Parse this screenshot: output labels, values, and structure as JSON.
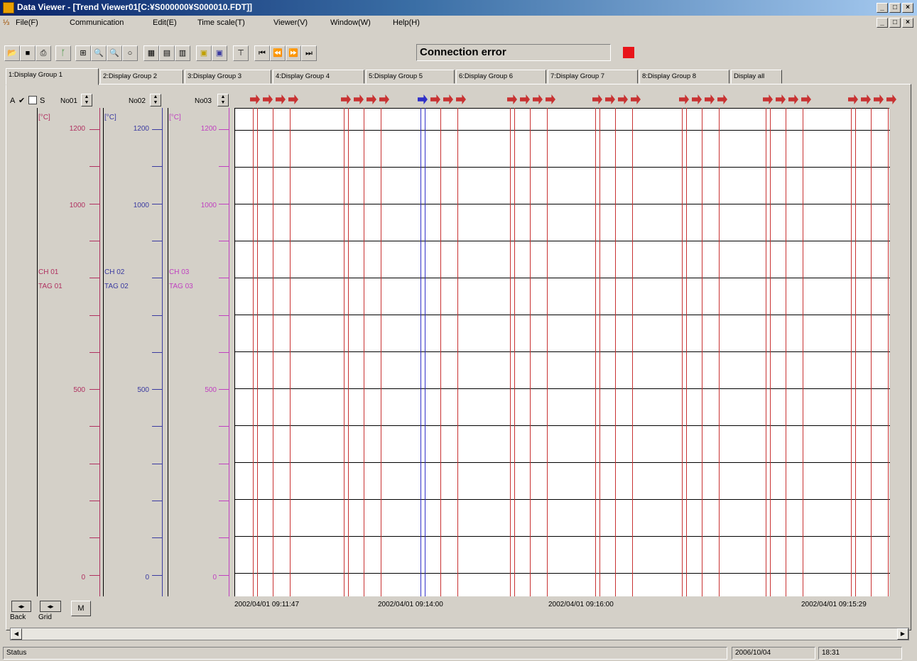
{
  "window": {
    "title": "Data Viewer - [Trend Viewer01[C:¥S000000¥S000010.FDT]]",
    "minimize_glyph": "_",
    "maximize_glyph": "□",
    "close_glyph": "×"
  },
  "menu": [
    "File(F)",
    "Communication",
    "Edit(E)",
    "Time scale(T)",
    "Viewer(V)",
    "Window(W)",
    "Help(H)"
  ],
  "toolbar": {
    "connection_status": "Connection error",
    "status_color": "#e8141a"
  },
  "tabs": [
    "1:Display Group 1",
    "2:Display Group 2",
    "3:Display Group 3",
    "4:Display Group 4",
    "5:Display Group 5",
    "6:Display Group 6",
    "7:Display Group 7",
    "8:Display Group 8",
    "Display all"
  ],
  "header_controls": {
    "a_label": "A",
    "check1": "✔",
    "s_label": "S",
    "no01": "No01",
    "no02": "No02",
    "no03": "No03"
  },
  "scales": [
    {
      "unit": "[°C]",
      "ticks": [
        "1200",
        "1000",
        "500",
        "0"
      ],
      "ch": "CH 01",
      "tag": "TAG 01",
      "color": "#b03060"
    },
    {
      "unit": "[°C]",
      "ticks": [
        "1200",
        "1000",
        "500",
        "0"
      ],
      "ch": "CH 02",
      "tag": "TAG 02",
      "color": "#3a3aa0"
    },
    {
      "unit": "[°C]",
      "ticks": [
        "1200",
        "1000",
        "500",
        "0"
      ],
      "ch": "CH 03",
      "tag": "TAG 03",
      "color": "#c040c0"
    }
  ],
  "time_labels": [
    "2002/04/01 09:11:47",
    "2002/04/01 09:14:00",
    "2002/04/01 09:16:00",
    "2002/04/01 09:15:29"
  ],
  "bottom_controls": {
    "back_label": "Back",
    "grid_label": "Grid",
    "m_label": "M"
  },
  "statusbar": {
    "status": "Status",
    "date": "2006/10/04",
    "time": "18:31"
  },
  "colors": {
    "event_line": "#c83232",
    "selected_line": "#3030c8",
    "axis_red": "#b03060",
    "axis_blue": "#3a3aa0",
    "axis_magenta": "#c040c0"
  }
}
